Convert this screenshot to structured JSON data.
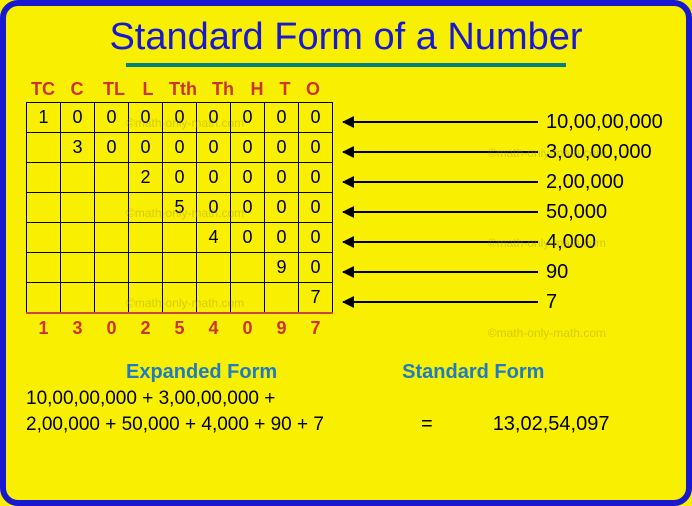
{
  "title": "Standard Form of a Number",
  "place_headers": [
    "TC",
    "C",
    "TL",
    "L",
    "Tth",
    "Th",
    "H",
    "T",
    "O"
  ],
  "rows": [
    [
      "1",
      "0",
      "0",
      "0",
      "0",
      "0",
      "0",
      "0",
      "0"
    ],
    [
      "",
      "3",
      "0",
      "0",
      "0",
      "0",
      "0",
      "0",
      "0"
    ],
    [
      "",
      "",
      "",
      "2",
      "0",
      "0",
      "0",
      "0",
      "0"
    ],
    [
      "",
      "",
      "",
      "",
      "5",
      "0",
      "0",
      "0",
      "0"
    ],
    [
      "",
      "",
      "",
      "",
      "",
      "4",
      "0",
      "0",
      "0"
    ],
    [
      "",
      "",
      "",
      "",
      "",
      "",
      "",
      "9",
      "0"
    ],
    [
      "",
      "",
      "",
      "",
      "",
      "",
      "",
      "",
      "7"
    ]
  ],
  "sum_row": [
    "1",
    "3",
    "0",
    "2",
    "5",
    "4",
    "0",
    "9",
    "7"
  ],
  "arrow_labels": [
    "10,00,00,000",
    "3,00,00,000",
    "2,00,000",
    "50,000",
    "4,000",
    "90",
    "7"
  ],
  "expanded_label": "Expanded Form",
  "standard_label": "Standard Form",
  "expanded_line1": "10,00,00,000 + 3,00,00,000 +",
  "expanded_line2": "2,00,000 + 50,000 + 4,000 + 90 + 7",
  "equals": "=",
  "standard_result": "13,02,54,097",
  "watermark": "©math-only-math.com",
  "chart_data": {
    "type": "table",
    "title": "Standard Form of a Number",
    "columns": [
      "TC",
      "C",
      "TL",
      "L",
      "Tth",
      "Th",
      "H",
      "T",
      "O"
    ],
    "rows": [
      {
        "digits": [
          1,
          0,
          0,
          0,
          0,
          0,
          0,
          0,
          0
        ],
        "value": "10,00,00,000"
      },
      {
        "digits": [
          null,
          3,
          0,
          0,
          0,
          0,
          0,
          0,
          0
        ],
        "value": "3,00,00,000"
      },
      {
        "digits": [
          null,
          null,
          null,
          2,
          0,
          0,
          0,
          0,
          0
        ],
        "value": "2,00,000"
      },
      {
        "digits": [
          null,
          null,
          null,
          null,
          5,
          0,
          0,
          0,
          0
        ],
        "value": "50,000"
      },
      {
        "digits": [
          null,
          null,
          null,
          null,
          null,
          4,
          0,
          0,
          0
        ],
        "value": "4,000"
      },
      {
        "digits": [
          null,
          null,
          null,
          null,
          null,
          null,
          null,
          9,
          0
        ],
        "value": "90"
      },
      {
        "digits": [
          null,
          null,
          null,
          null,
          null,
          null,
          null,
          null,
          7
        ],
        "value": "7"
      }
    ],
    "sum": [
      1,
      3,
      0,
      2,
      5,
      4,
      0,
      9,
      7
    ],
    "expanded_form": "10,00,00,000 + 3,00,00,000 + 2,00,000 + 50,000 + 4,000 + 90 + 7",
    "standard_form": "13,02,54,097"
  }
}
